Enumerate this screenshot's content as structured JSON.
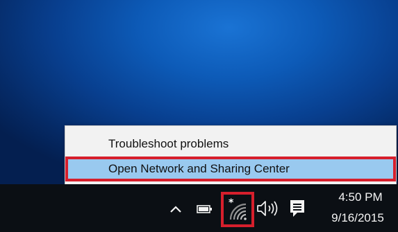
{
  "context_menu": {
    "items": [
      {
        "label": "Troubleshoot problems"
      },
      {
        "label": "Open Network and Sharing Center"
      }
    ]
  },
  "taskbar": {
    "tray_icons": [
      {
        "icon": "chevron-up-icon"
      },
      {
        "icon": "battery-icon"
      },
      {
        "icon": "wifi-icon"
      },
      {
        "icon": "volume-icon"
      },
      {
        "icon": "action-center-icon"
      }
    ],
    "clock": {
      "time": "4:50 PM",
      "date": "9/16/2015"
    }
  },
  "colors": {
    "highlight_border": "#d61f2c",
    "menu_selected_bg": "#99c9ef",
    "taskbar_bg": "#0b0f14"
  }
}
